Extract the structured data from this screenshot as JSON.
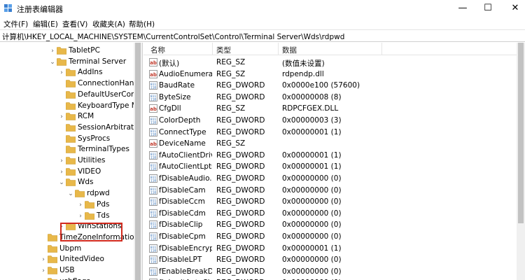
{
  "window": {
    "title": "注册表编辑器",
    "min_glyph": "—",
    "max_glyph": "☐",
    "close_glyph": "✕"
  },
  "menu": [
    "文件(F)",
    "编辑(E)",
    "查看(V)",
    "收藏夹(A)",
    "帮助(H)"
  ],
  "address": "计算机\\HKEY_LOCAL_MACHINE\\SYSTEM\\CurrentControlSet\\Control\\Terminal Server\\Wds\\rdpwd",
  "tree": [
    {
      "label": "TabletPC",
      "chev": "›"
    },
    {
      "label": "Terminal Server",
      "chev": "⌄"
    },
    {
      "label": "AddIns",
      "chev": "›"
    },
    {
      "label": "ConnectionHandle",
      "chev": ""
    },
    {
      "label": "DefaultUserConfig",
      "chev": ""
    },
    {
      "label": "KeyboardType M",
      "chev": ""
    },
    {
      "label": "RCM",
      "chev": "›"
    },
    {
      "label": "SessionArbitration",
      "chev": ""
    },
    {
      "label": "SysProcs",
      "chev": ""
    },
    {
      "label": "TerminalTypes",
      "chev": ""
    },
    {
      "label": "Utilities",
      "chev": "›"
    },
    {
      "label": "VIDEO",
      "chev": "›"
    },
    {
      "label": "Wds",
      "chev": "⌄"
    },
    {
      "label": "rdpwd",
      "chev": "⌄"
    },
    {
      "label": "Pds",
      "chev": "›"
    },
    {
      "label": "Tds",
      "chev": "›"
    },
    {
      "label": "WinStations",
      "chev": "›"
    },
    {
      "label": "TimeZoneInformatio",
      "chev": ""
    },
    {
      "label": "Ubpm",
      "chev": ""
    },
    {
      "label": "UnitedVideo",
      "chev": "›"
    },
    {
      "label": "USB",
      "chev": "›"
    },
    {
      "label": "usbflags",
      "chev": "›"
    }
  ],
  "columns": {
    "name": "名称",
    "type": "类型",
    "data": "数据"
  },
  "values": [
    {
      "icon": "string-value-icon",
      "name": "(默认)",
      "type": "REG_SZ",
      "data": "(数值未设置)"
    },
    {
      "icon": "string-value-icon",
      "name": "AudioEnumera...",
      "type": "REG_SZ",
      "data": "rdpendp.dll"
    },
    {
      "icon": "binary-value-icon",
      "name": "BaudRate",
      "type": "REG_DWORD",
      "data": "0x0000e100 (57600)"
    },
    {
      "icon": "binary-value-icon",
      "name": "ByteSize",
      "type": "REG_DWORD",
      "data": "0x00000008 (8)"
    },
    {
      "icon": "string-value-icon",
      "name": "CfgDll",
      "type": "REG_SZ",
      "data": "RDPCFGEX.DLL"
    },
    {
      "icon": "binary-value-icon",
      "name": "ColorDepth",
      "type": "REG_DWORD",
      "data": "0x00000003 (3)"
    },
    {
      "icon": "binary-value-icon",
      "name": "ConnectType",
      "type": "REG_DWORD",
      "data": "0x00000001 (1)"
    },
    {
      "icon": "string-value-icon",
      "name": "DeviceName",
      "type": "REG_SZ",
      "data": ""
    },
    {
      "icon": "binary-value-icon",
      "name": "fAutoClientDriv...",
      "type": "REG_DWORD",
      "data": "0x00000001 (1)"
    },
    {
      "icon": "binary-value-icon",
      "name": "fAutoClientLpts",
      "type": "REG_DWORD",
      "data": "0x00000001 (1)"
    },
    {
      "icon": "binary-value-icon",
      "name": "fDisableAudio...",
      "type": "REG_DWORD",
      "data": "0x00000000 (0)"
    },
    {
      "icon": "binary-value-icon",
      "name": "fDisableCam",
      "type": "REG_DWORD",
      "data": "0x00000000 (0)"
    },
    {
      "icon": "binary-value-icon",
      "name": "fDisableCcm",
      "type": "REG_DWORD",
      "data": "0x00000000 (0)"
    },
    {
      "icon": "binary-value-icon",
      "name": "fDisableCdm",
      "type": "REG_DWORD",
      "data": "0x00000000 (0)"
    },
    {
      "icon": "binary-value-icon",
      "name": "fDisableClip",
      "type": "REG_DWORD",
      "data": "0x00000000 (0)"
    },
    {
      "icon": "binary-value-icon",
      "name": "fDisableCpm",
      "type": "REG_DWORD",
      "data": "0x00000000 (0)"
    },
    {
      "icon": "binary-value-icon",
      "name": "fDisableEncryp...",
      "type": "REG_DWORD",
      "data": "0x00000001 (1)"
    },
    {
      "icon": "binary-value-icon",
      "name": "fDisableLPT",
      "type": "REG_DWORD",
      "data": "0x00000000 (0)"
    },
    {
      "icon": "binary-value-icon",
      "name": "fEnableBreakD...",
      "type": "REG_DWORD",
      "data": "0x00000000 (0)"
    },
    {
      "icon": "binary-value-icon",
      "name": "fInheritAutoCl...",
      "type": "REG_DWORD",
      "data": "0x00000000 (0)"
    }
  ],
  "colors": {
    "folder": "#e8b84a",
    "selection_outline": "#d22a1e",
    "string_icon": "#c0392b",
    "binary_icon": "#2f6db5"
  }
}
